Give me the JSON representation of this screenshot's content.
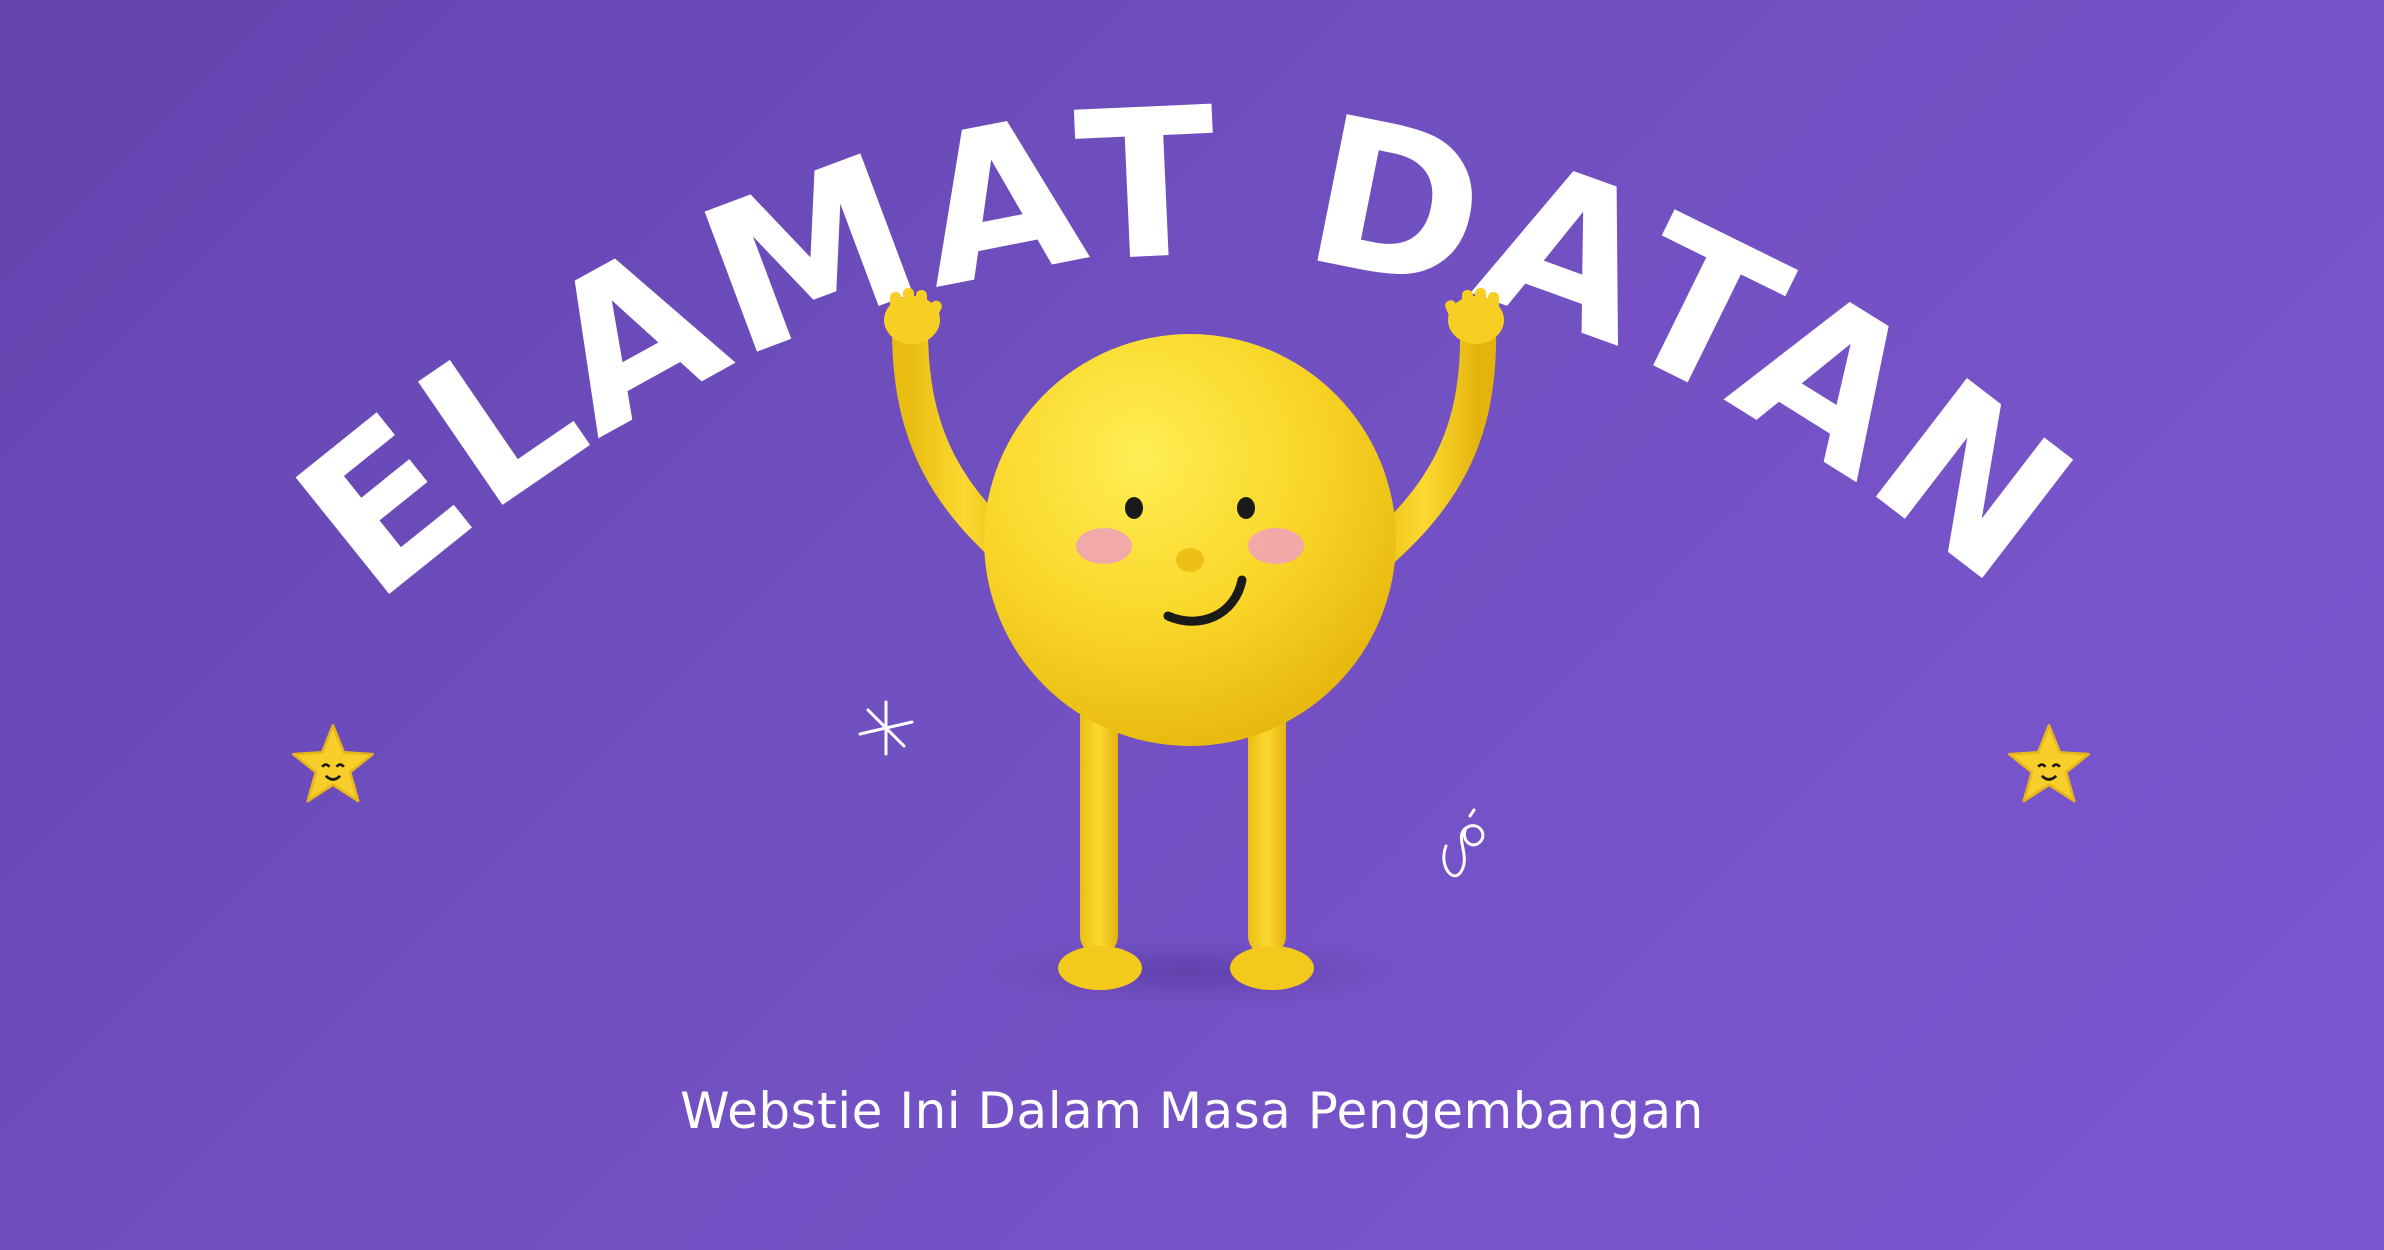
{
  "headline": "SELAMAT DATANG",
  "subtitle": "Webstie Ini Dalam Masa Pengembangan",
  "colors": {
    "background_start": "#6344ae",
    "background_end": "#7d57d1",
    "text": "#ffffff",
    "mascot": "#f9d628",
    "cheek": "#f2a3b6"
  },
  "icons": [
    "star-icon",
    "sparkle-icon",
    "squiggle-icon",
    "mascot-illustration"
  ]
}
